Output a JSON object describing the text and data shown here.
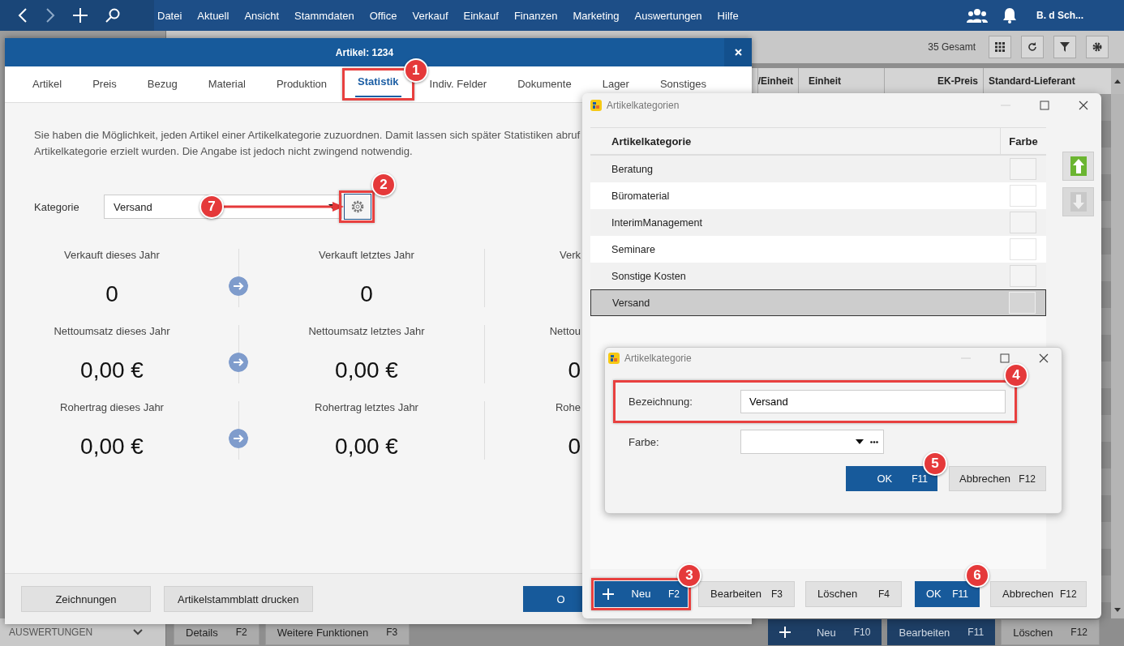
{
  "top_bar": {
    "menu": [
      "Datei",
      "Aktuell",
      "Ansicht",
      "Stammdaten",
      "Office",
      "Verkauf",
      "Einkauf",
      "Finanzen",
      "Marketing",
      "Auswertungen",
      "Hilfe"
    ],
    "user": "B. d Sch..."
  },
  "background": {
    "total": "35 Gesamt",
    "columns": [
      "/Einheit",
      "Einheit",
      "EK-Preis",
      "Standard-Lieferant"
    ],
    "sidebar_section": "AUSWERTUNGEN",
    "left_buttons": [
      {
        "label": "Details",
        "key": "F2",
        "kind": "plain"
      },
      {
        "label": "Weitere Funktionen",
        "key": "F3",
        "kind": "plain"
      }
    ],
    "right_buttons": [
      {
        "label": "Neu",
        "key": "F10",
        "kind": "add"
      },
      {
        "label": "Bearbeiten",
        "key": "F11",
        "kind": "primary"
      },
      {
        "label": "Löschen",
        "key": "F12",
        "kind": "plain"
      }
    ]
  },
  "article_window": {
    "title": "Artikel: 1234",
    "tabs": [
      {
        "label": "Artikel",
        "selected": false
      },
      {
        "label": "Preis",
        "selected": false
      },
      {
        "label": "Bezug",
        "selected": false
      },
      {
        "label": "Material",
        "selected": false
      },
      {
        "label": "Produktion",
        "selected": false
      },
      {
        "label": "Statistik",
        "selected": true,
        "callout": {
          "number": "1",
          "kind": "boxed"
        }
      },
      {
        "label": "Indiv. Felder",
        "selected": false
      },
      {
        "label": "Dokumente",
        "selected": false
      },
      {
        "label": "Lager",
        "selected": false
      },
      {
        "label": "Sonstiges",
        "selected": false
      }
    ],
    "intro_lines": [
      "Sie haben die Möglichkeit, jeden Artikel einer Artikelkategorie zuzuordnen. Damit lassen sich später Statistiken abruf",
      "Artikelkategorie erzielt wurden. Die Angabe ist jedoch nicht zwingend notwendig."
    ],
    "category": {
      "label": "Kategorie",
      "value": "Versand",
      "callout": {
        "number": "7",
        "kind": "arrow"
      },
      "settings_callout": {
        "number": "2",
        "kind": "boxed"
      }
    },
    "stats": [
      {
        "cells": [
          {
            "label": "Verkauft dieses Jahr",
            "value": "0"
          },
          {
            "label": "Verkauft letztes Jahr",
            "value": "0"
          },
          {
            "label": "Verk"
          }
        ]
      },
      {
        "cells": [
          {
            "label": "Nettoumsatz dieses Jahr",
            "value": "0,00 €"
          },
          {
            "label": "Nettoumsatz letztes Jahr",
            "value": "0,00 €"
          },
          {
            "label": "Nettou",
            "value": "0"
          }
        ]
      },
      {
        "cells": [
          {
            "label": "Rohertrag dieses Jahr",
            "value": "0,00 €"
          },
          {
            "label": "Rohertrag letztes Jahr",
            "value": "0,00 €"
          },
          {
            "label": "Rohe",
            "value": "0"
          }
        ]
      }
    ],
    "footer_buttons": [
      {
        "label": "Zeichnungen",
        "kind": "plain"
      },
      {
        "label": "Artikelstammblatt drucken",
        "kind": "plain"
      }
    ],
    "ok_button": "O"
  },
  "categories_dialog": {
    "title": "Artikelkategorien",
    "columns": [
      "Artikelkategorie",
      "Farbe"
    ],
    "rows": [
      {
        "name": "Beratung",
        "selected": false
      },
      {
        "name": "Büromaterial",
        "selected": false
      },
      {
        "name": "InterimManagement",
        "selected": false
      },
      {
        "name": "Seminare",
        "selected": false
      },
      {
        "name": "Sonstige Kosten",
        "selected": false
      },
      {
        "name": "Versand",
        "selected": true
      }
    ],
    "move_up": {
      "disabled": false
    },
    "move_down": {
      "disabled": true
    },
    "buttons": [
      {
        "label": "Neu",
        "key": "F2",
        "kind": "add",
        "callout": {
          "number": "3",
          "kind": "boxed"
        }
      },
      {
        "label": "Bearbeiten",
        "key": "F3",
        "kind": "plain"
      },
      {
        "label": "Löschen",
        "key": "F4",
        "kind": "plain"
      },
      {
        "label": "OK",
        "key": "F11",
        "kind": "primary",
        "callout": {
          "number": "6",
          "kind": "badge"
        }
      },
      {
        "label": "Abbrechen",
        "key": "F12",
        "kind": "plain"
      }
    ]
  },
  "category_dialog": {
    "title": "Artikelkategorie",
    "fields": [
      {
        "label": "Bezeichnung:",
        "value": "Versand",
        "kind": "text",
        "callout": {
          "number": "4",
          "kind": "boxed"
        }
      },
      {
        "label": "Farbe:",
        "kind": "color"
      }
    ],
    "buttons": [
      {
        "label": "OK",
        "key": "F11",
        "kind": "primary",
        "callout": {
          "number": "5",
          "kind": "badge"
        }
      },
      {
        "label": "Abbrechen",
        "key": "F12",
        "kind": "plain"
      }
    ]
  }
}
